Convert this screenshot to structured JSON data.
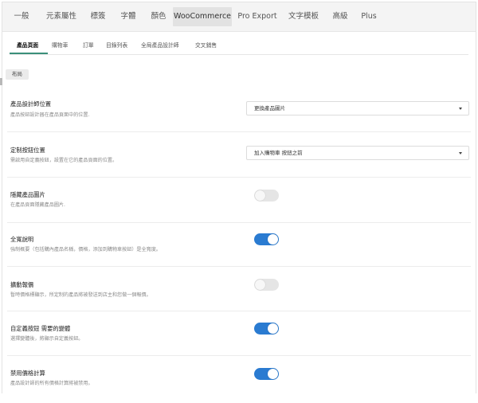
{
  "top_tabs": [
    {
      "label": "一般"
    },
    {
      "label": "元素屬性"
    },
    {
      "label": "標簽"
    },
    {
      "label": "字體"
    },
    {
      "label": "顏色"
    },
    {
      "label": "WooCommerce",
      "active": true
    },
    {
      "label": "Pro Export"
    },
    {
      "label": "文字模板"
    },
    {
      "label": "高級"
    },
    {
      "label": "Plus"
    }
  ],
  "sub_tabs": [
    {
      "label": "產品頁面",
      "active": true
    },
    {
      "label": "購物車"
    },
    {
      "label": "訂單"
    },
    {
      "label": "目錄列表"
    },
    {
      "label": "全局產品設計師"
    },
    {
      "label": "交叉銷售"
    }
  ],
  "section_label": "布局",
  "settings": [
    {
      "title": "產品設計師位置",
      "desc": "產品按鈕設計器在產品頁面中的位置.",
      "type": "select",
      "value": "更換產品圖片"
    },
    {
      "title": "定制按鈕位置",
      "desc": "需啟用自定義按鈕，設置在它的產品頁面的位置。",
      "type": "select",
      "value": "加入購物車 按鈕之前"
    },
    {
      "title": "隱藏產品圖片",
      "desc": "在產品頁面隱藏產品圖片.",
      "type": "toggle",
      "on": false
    },
    {
      "title": "全寬說明",
      "desc": "強制概要（包括購內產品名稱，價格，添加到購物車按鈕）是全寬度。",
      "type": "toggle",
      "on": true
    },
    {
      "title": "擴動報價",
      "desc": "暫時價格標顯示，所定制的產品將被發送到店主和您做一個報價。",
      "type": "toggle",
      "on": false
    },
    {
      "title": "自定義按鈕 需要的變體",
      "desc": "選擇變體後，將顯示自定義按鈕。",
      "type": "toggle",
      "on": true
    },
    {
      "title": "禁用價格計算",
      "desc": "產品設計師的所有價格計算將被禁用。",
      "type": "toggle",
      "on": true
    }
  ],
  "colors": {
    "accent": "#2a7bd1",
    "tab_underline": "#3a8f7a"
  }
}
